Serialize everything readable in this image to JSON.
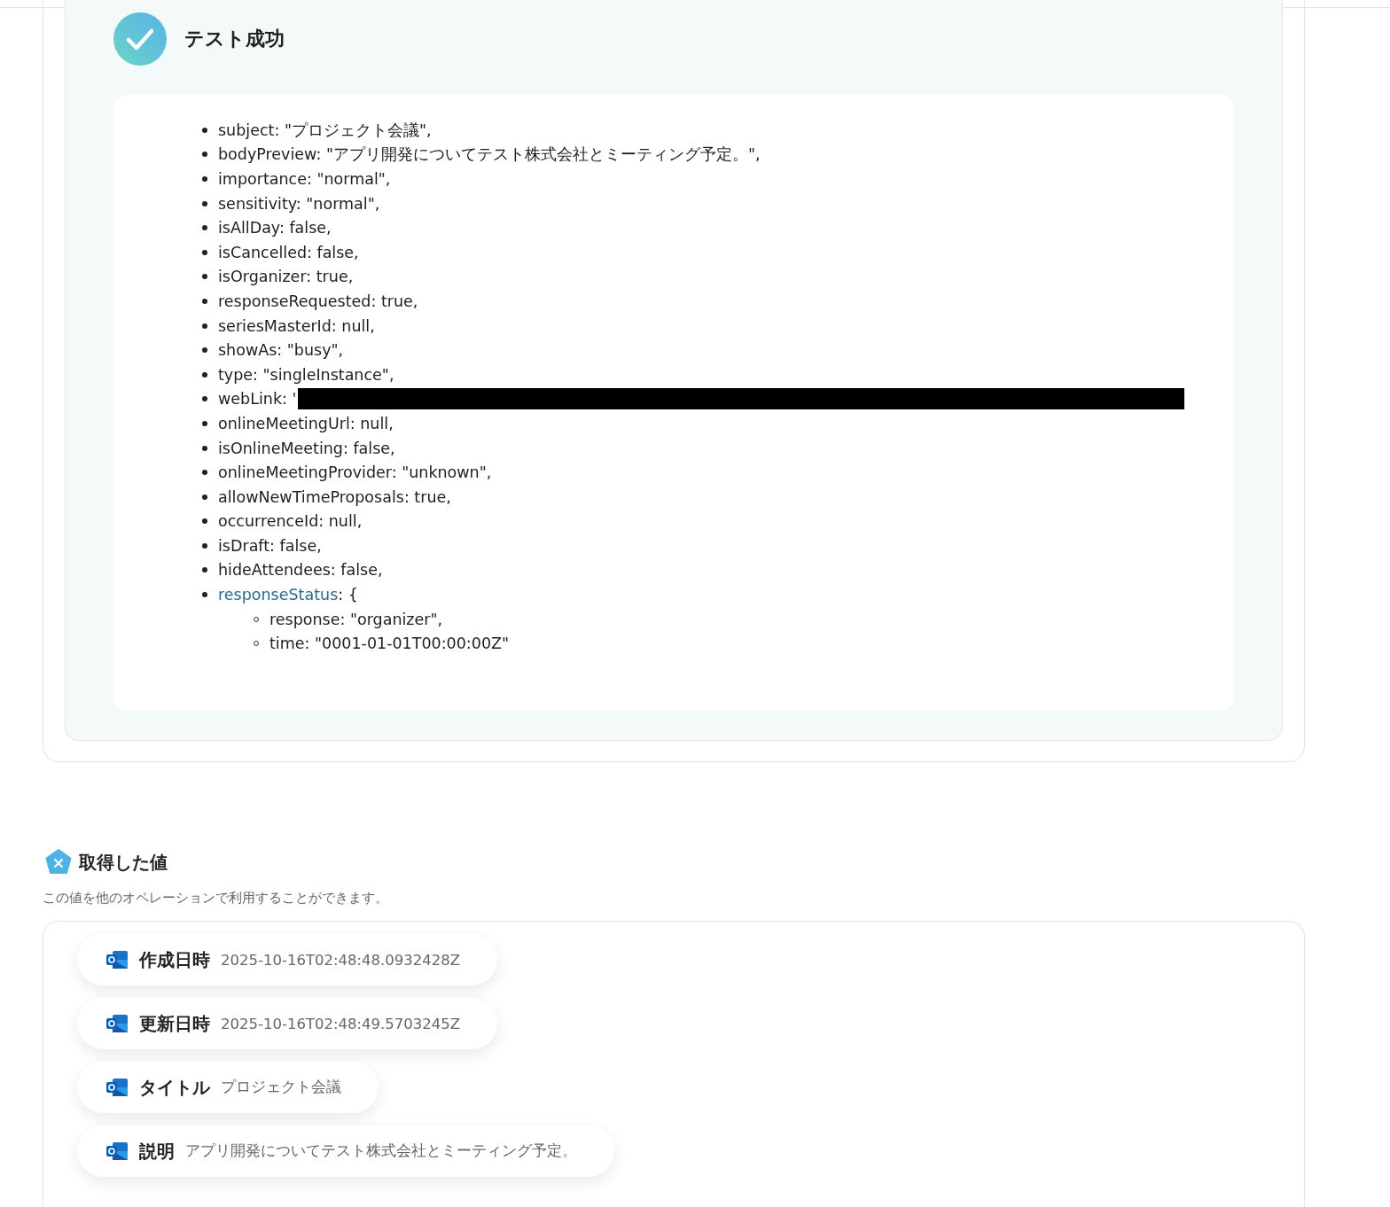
{
  "test_result": {
    "title": "テスト成功",
    "fields": [
      {
        "key": "subject",
        "value": ": \"プロジェクト会議\","
      },
      {
        "key": "bodyPreview",
        "value": ": \"アプリ開発についてテスト株式会社とミーティング予定。\","
      },
      {
        "key": "importance",
        "value": ": \"normal\","
      },
      {
        "key": "sensitivity",
        "value": ": \"normal\","
      },
      {
        "key": "isAllDay",
        "value": ": false,"
      },
      {
        "key": "isCancelled",
        "value": ": false,"
      },
      {
        "key": "isOrganizer",
        "value": ": true,"
      },
      {
        "key": "responseRequested",
        "value": ": true,"
      },
      {
        "key": "seriesMasterId",
        "value": ": null,"
      },
      {
        "key": "showAs",
        "value": ": \"busy\","
      },
      {
        "key": "type",
        "value": ": \"singleInstance\","
      },
      {
        "key": "webLink",
        "value": ": '",
        "redacted": true
      },
      {
        "key": "onlineMeetingUrl",
        "value": ": null,"
      },
      {
        "key": "isOnlineMeeting",
        "value": ": false,"
      },
      {
        "key": "onlineMeetingProvider",
        "value": ": \"unknown\","
      },
      {
        "key": "allowNewTimeProposals",
        "value": ": true,"
      },
      {
        "key": "occurrenceId",
        "value": ": null,"
      },
      {
        "key": "isDraft",
        "value": ": false,"
      },
      {
        "key": "hideAttendees",
        "value": ": false,"
      },
      {
        "key": "responseStatus",
        "value": ": {",
        "children": [
          {
            "key": "response",
            "value": ": \"organizer\","
          },
          {
            "key": "time",
            "value": ": \"0001-01-01T00:00:00Z\""
          }
        ]
      }
    ]
  },
  "obtained_values": {
    "title": "取得した値",
    "description": "この値を他のオペレーションで利用することができます。",
    "items": [
      {
        "label": "作成日時",
        "value": "2025-10-16T02:48:48.0932428Z"
      },
      {
        "label": "更新日時",
        "value": "2025-10-16T02:48:49.5703245Z"
      },
      {
        "label": "タイトル",
        "value": "プロジェクト会議"
      },
      {
        "label": "説明",
        "value": "アプリ開発についてテスト株式会社とミーティング予定。"
      }
    ]
  }
}
